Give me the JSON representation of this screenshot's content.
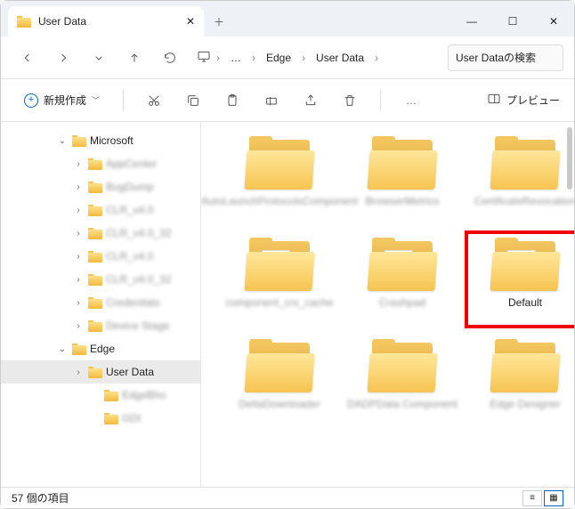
{
  "window": {
    "title": "User Data"
  },
  "nav": {
    "breadcrumbs_prefix": "…",
    "crumb1": "Edge",
    "crumb2": "User Data"
  },
  "search": {
    "placeholder": "User Dataの検索"
  },
  "toolbar": {
    "new_label": "新規作成",
    "preview_label": "プレビュー",
    "more": "…"
  },
  "tree": {
    "root": "Microsoft",
    "items": [
      "AppCenter",
      "BugDump",
      "CLR_v4.0",
      "CLR_v4.0_32",
      "CLR_v4.0",
      "CLR_v4.0_32",
      "Credentials",
      "Device Stage"
    ],
    "edge": "Edge",
    "userdata": "User Data",
    "after": [
      "EdgeBho",
      "GDI"
    ]
  },
  "grid": {
    "items": [
      {
        "name": "AutoLaunchProtocolsComponent",
        "blur": true,
        "doc": false
      },
      {
        "name": "BrowserMetrics",
        "blur": true,
        "doc": false
      },
      {
        "name": "CertificateRevocation",
        "blur": true,
        "doc": false
      },
      {
        "name": "component_crx_cache",
        "blur": true,
        "doc": true
      },
      {
        "name": "Crashpad",
        "blur": true,
        "doc": true,
        "black": true
      },
      {
        "name": "Default",
        "blur": false,
        "doc": true,
        "highlight": true
      },
      {
        "name": "DeltaDownloader",
        "blur": true,
        "doc": false
      },
      {
        "name": "DADPData Component",
        "blur": true,
        "doc": false
      },
      {
        "name": "Edge Designer",
        "blur": true,
        "doc": false
      }
    ]
  },
  "status": {
    "text": "57 個の項目"
  }
}
